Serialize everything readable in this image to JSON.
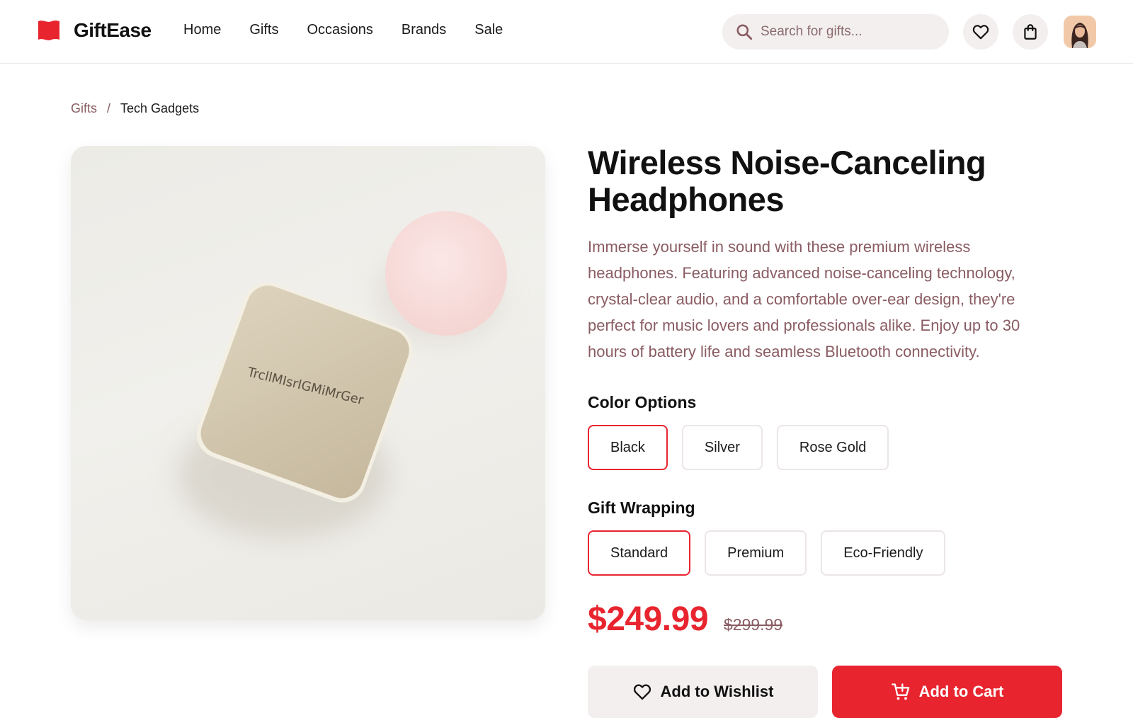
{
  "brand": {
    "name": "GiftEase",
    "color": "#e8252f"
  },
  "nav": {
    "items": [
      "Home",
      "Gifts",
      "Occasions",
      "Brands",
      "Sale"
    ]
  },
  "search": {
    "placeholder": "Search for gifts...",
    "value": ""
  },
  "header_icons": [
    "search-icon",
    "heart-icon",
    "shopping-bag-icon",
    "avatar"
  ],
  "breadcrumb": {
    "parent": "Gifts",
    "separator": "/",
    "current": "Tech Gadgets"
  },
  "product": {
    "image_label": "TrcllMIsrIGMiMrGer",
    "title": "Wireless Noise-Canceling Headphones",
    "description": "Immerse yourself in sound with these premium wireless headphones. Featuring advanced noise-canceling technology, crystal-clear audio, and a comfortable over-ear design, they're perfect for music lovers and professionals alike. Enjoy up to 30 hours of battery life and seamless Bluetooth connectivity.",
    "color_label": "Color Options",
    "colors": [
      "Black",
      "Silver",
      "Rose Gold"
    ],
    "selected_color": "Black",
    "wrap_label": "Gift Wrapping",
    "wraps": [
      "Standard",
      "Premium",
      "Eco-Friendly"
    ],
    "selected_wrap": "Standard",
    "price": "$249.99",
    "old_price": "$299.99"
  },
  "actions": {
    "wishlist_label": "Add to Wishlist",
    "cart_label": "Add to Cart"
  },
  "colors": {
    "accent": "#e8252f",
    "muted_text": "#8a5c63",
    "surface": "#f3efef"
  }
}
